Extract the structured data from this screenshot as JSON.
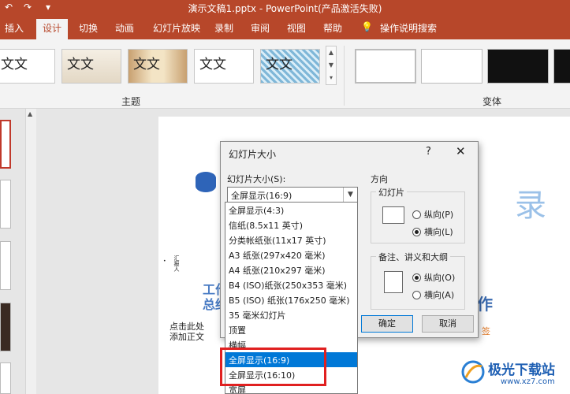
{
  "window": {
    "title": "演示文稿1.pptx - PowerPoint(产品激活失败)"
  },
  "quick_access": {
    "icons": [
      "undo-icon",
      "redo-icon",
      "customize-icon"
    ]
  },
  "tabs": [
    {
      "label": "插入"
    },
    {
      "label": "设计",
      "active": true
    },
    {
      "label": "切换"
    },
    {
      "label": "动画"
    },
    {
      "label": "幻灯片放映"
    },
    {
      "label": "录制"
    },
    {
      "label": "审阅"
    },
    {
      "label": "视图"
    },
    {
      "label": "帮助"
    },
    {
      "label": "操作说明搜索",
      "icon": "lightbulb-icon"
    }
  ],
  "ribbon": {
    "themes_group_label": "主题",
    "variants_group_label": "变体",
    "theme_thumbnails": [
      "文文",
      "文文",
      "文文",
      "文文",
      "文文"
    ]
  },
  "slide": {
    "texts": [
      "汇报人",
      "点击此处添加正文",
      "录",
      "工作",
      "总结",
      "作",
      "签"
    ]
  },
  "dialog": {
    "title": "幻灯片大小",
    "help_label": "?",
    "close_label": "✕",
    "size_label": "幻灯片大小(S):",
    "size_value": "全屏显示(16:9)",
    "orientation_label": "方向",
    "slides_group": "幻灯片",
    "slides_portrait": "纵向(P)",
    "slides_landscape": "横向(L)",
    "notes_group": "备注、讲义和大纲",
    "notes_portrait": "纵向(O)",
    "notes_landscape": "横向(A)",
    "ok_label": "确定",
    "cancel_label": "取消"
  },
  "dropdown_options": [
    "全屏显示(4:3)",
    "信纸(8.5x11 英寸)",
    "分类帐纸张(11x17 英寸)",
    "A3 纸张(297x420 毫米)",
    "A4 纸张(210x297 毫米)",
    "B4 (ISO)纸张(250x353 毫米)",
    "B5 (ISO) 纸张(176x250 毫米)",
    "35 毫米幻灯片",
    "顶置",
    "横幅",
    "全屏显示(16:9)",
    "全屏显示(16:10)",
    "宽屏"
  ],
  "dropdown_selected": "全屏显示(16:9)",
  "watermark": {
    "text": "极光下载站",
    "url": "www.xz7.com"
  },
  "colors": {
    "accent": "#b7472a",
    "selection": "#0078d7",
    "highlight_box": "#e02020"
  }
}
